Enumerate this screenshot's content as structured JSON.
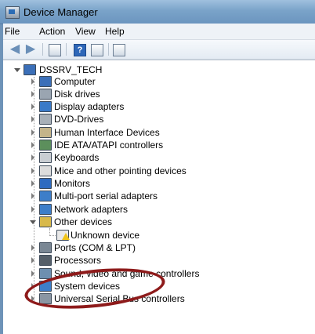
{
  "window": {
    "title": "Device Manager"
  },
  "menu": {
    "file": "File",
    "action": "Action",
    "view": "View",
    "help": "Help"
  },
  "toolbar": {
    "help_glyph": "?"
  },
  "tree": {
    "root": "DSSRV_TECH",
    "items": [
      {
        "label": "Computer",
        "icon": "computer-icon",
        "color": "#3b6fb8"
      },
      {
        "label": "Disk drives",
        "icon": "disk-drive-icon",
        "color": "#9aa5b1"
      },
      {
        "label": "Display adapters",
        "icon": "display-adapter-icon",
        "color": "#3a7ac8"
      },
      {
        "label": "DVD-Drives",
        "icon": "dvd-drive-icon",
        "color": "#a8b0b8"
      },
      {
        "label": "Human Interface Devices",
        "icon": "hid-icon",
        "color": "#c4b48a"
      },
      {
        "label": "IDE ATA/ATAPI controllers",
        "icon": "ide-controller-icon",
        "color": "#5c8f5c"
      },
      {
        "label": "Keyboards",
        "icon": "keyboard-icon",
        "color": "#c9cdd2"
      },
      {
        "label": "Mice and other pointing devices",
        "icon": "mouse-icon",
        "color": "#dcdcdc"
      },
      {
        "label": "Monitors",
        "icon": "monitor-icon",
        "color": "#2e6bc0"
      },
      {
        "label": "Multi-port serial adapters",
        "icon": "serial-adapter-icon",
        "color": "#3d7ec9"
      },
      {
        "label": "Network adapters",
        "icon": "network-adapter-icon",
        "color": "#3d7ec9"
      },
      {
        "label": "Other devices",
        "icon": "other-devices-icon",
        "color": "#d8b94a"
      },
      {
        "label": "Unknown device",
        "icon": "unknown-device-warning-icon",
        "color": "#f0c419"
      },
      {
        "label": "Ports (COM & LPT)",
        "icon": "ports-icon",
        "color": "#7a8794"
      },
      {
        "label": "Processors",
        "icon": "processor-icon",
        "color": "#555f69"
      },
      {
        "label": "Sound, video and game controllers",
        "icon": "sound-icon",
        "color": "#6d8fb0"
      },
      {
        "label": "System devices",
        "icon": "system-devices-icon",
        "color": "#3d7ec9"
      },
      {
        "label": "Universal Serial Bus controllers",
        "icon": "usb-icon",
        "color": "#8a96a3"
      }
    ]
  },
  "annotation": {
    "color": "#8e1b1b"
  }
}
